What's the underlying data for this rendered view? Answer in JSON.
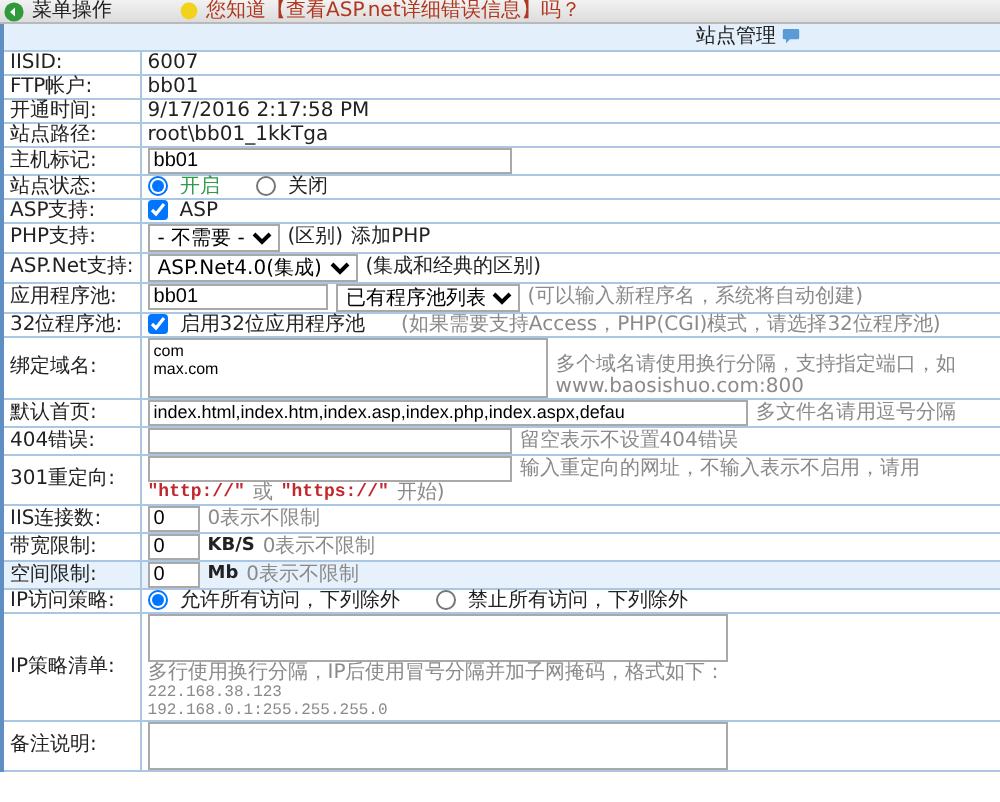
{
  "toolbar": {
    "menu_label": "菜单操作",
    "tip": "您知道【查看ASP.net详细错误信息】吗？"
  },
  "panel": {
    "title": "站点管理"
  },
  "rows": [
    {
      "label": "IISID:",
      "highlighted": false,
      "items": [
        {
          "kind": "text",
          "text": "6007"
        }
      ]
    },
    {
      "label": "FTP帐户:",
      "highlighted": false,
      "items": [
        {
          "kind": "text",
          "text": "bb01"
        }
      ]
    },
    {
      "label": "开通时间:",
      "highlighted": false,
      "items": [
        {
          "kind": "text",
          "text": "9/17/2016 2:17:58 PM"
        }
      ]
    },
    {
      "label": "站点路径:",
      "highlighted": false,
      "items": [
        {
          "kind": "text",
          "text": "root\\bb01_1kkTga"
        }
      ]
    },
    {
      "label": "主机标记:",
      "highlighted": false,
      "items": [
        {
          "kind": "field",
          "value": "bb01"
        }
      ]
    },
    {
      "label": "站点状态:",
      "highlighted": false,
      "items": [
        {
          "kind": "radio",
          "label": "开启",
          "selected": true,
          "color": "#2e9a4a"
        },
        {
          "kind": "radio",
          "label": "关闭",
          "selected": false,
          "color": "#222222"
        }
      ]
    },
    {
      "label": "ASP支持:",
      "highlighted": false,
      "items": [
        {
          "kind": "checkbox",
          "label": "ASP",
          "checked": true
        }
      ]
    },
    {
      "label": "PHP支持:",
      "highlighted": false,
      "items": [
        {
          "kind": "select",
          "value": "- 不需要 -"
        },
        {
          "kind": "link",
          "text": "(区别)"
        },
        {
          "kind": "link",
          "text": "添加PHP"
        }
      ]
    },
    {
      "label": "ASP.Net支持:",
      "highlighted": false,
      "items": [
        {
          "kind": "select",
          "value": "ASP.Net4.0(集成)"
        },
        {
          "kind": "link",
          "text": "(集成和经典的区别)"
        }
      ]
    },
    {
      "label": "应用程序池:",
      "highlighted": false,
      "items": [
        {
          "kind": "field-medium",
          "value": "bb01"
        },
        {
          "kind": "select",
          "value": "已有程序池列表"
        },
        {
          "kind": "hint",
          "text": "(可以输入新程序名，系统将自动创建)"
        }
      ]
    },
    {
      "label": "32位程序池:",
      "highlighted": false,
      "items": [
        {
          "kind": "checkbox",
          "label": "启用32位应用程序池",
          "checked": true
        },
        {
          "kind": "hint",
          "text": "(如果需要支持Access，PHP(CGI)模式，请选择32位程序池)"
        }
      ]
    },
    {
      "label": "绑定域名:",
      "highlighted": false,
      "items": [
        {
          "kind": "textarea-narrow",
          "value": "com\nmax.com"
        },
        {
          "kind": "hint-side",
          "text": "多个域名请使用换行分隔，支持指定端口，如 www.baosishuo.com:800"
        }
      ]
    },
    {
      "label": "默认首页:",
      "highlighted": false,
      "items": [
        {
          "kind": "field-wide",
          "value": "index.html,index.htm,index.asp,index.php,index.aspx,defau"
        },
        {
          "kind": "hint",
          "text": "多文件名请用逗号分隔"
        }
      ]
    },
    {
      "label": "404错误:",
      "highlighted": false,
      "items": [
        {
          "kind": "field",
          "value": ""
        },
        {
          "kind": "hint",
          "text": "留空表示不设置404错误"
        }
      ]
    },
    {
      "label": "301重定向:",
      "highlighted": false,
      "items": [
        {
          "kind": "field",
          "value": ""
        },
        {
          "kind": "hint",
          "text": "输入重定向的网址，不输入表示不启用，请用"
        },
        {
          "kind": "code",
          "text": "\"http://\""
        },
        {
          "kind": "hint",
          "text": "或"
        },
        {
          "kind": "code",
          "text": "\"https://\""
        },
        {
          "kind": "hint",
          "text": "开始)"
        }
      ]
    },
    {
      "label": "IIS连接数:",
      "highlighted": false,
      "items": [
        {
          "kind": "field-short",
          "value": "0"
        },
        {
          "kind": "hint",
          "text": "0表示不限制"
        }
      ]
    },
    {
      "label": "带宽限制:",
      "highlighted": false,
      "items": [
        {
          "kind": "field-short",
          "value": "0"
        },
        {
          "kind": "unit",
          "text": "KB/S"
        },
        {
          "kind": "hint",
          "text": "0表示不限制"
        }
      ]
    },
    {
      "label": "空间限制:",
      "highlighted": true,
      "items": [
        {
          "kind": "field-short",
          "value": "0"
        },
        {
          "kind": "unit",
          "text": "Mb"
        },
        {
          "kind": "hint",
          "text": "0表示不限制"
        }
      ]
    },
    {
      "label": "IP访问策略:",
      "highlighted": false,
      "items": [
        {
          "kind": "radio",
          "label": "允许所有访问，下列除外",
          "selected": true,
          "color": "#222222"
        },
        {
          "kind": "radio",
          "label": "禁止所有访问，下列除外",
          "selected": false,
          "color": "#222222"
        }
      ]
    },
    {
      "label": "IP策略清单:",
      "highlighted": false,
      "items": [
        {
          "kind": "textarea",
          "value": ""
        },
        {
          "kind": "hint-block",
          "text": "多行使用换行分隔，IP后使用冒号分隔并加子网掩码，格式如下："
        },
        {
          "kind": "example",
          "text": "222.168.38.123"
        },
        {
          "kind": "example",
          "text": "192.168.0.1:255.255.255.0"
        }
      ]
    },
    {
      "label": "备注说明:",
      "highlighted": false,
      "items": [
        {
          "kind": "textarea",
          "value": ""
        }
      ]
    }
  ]
}
